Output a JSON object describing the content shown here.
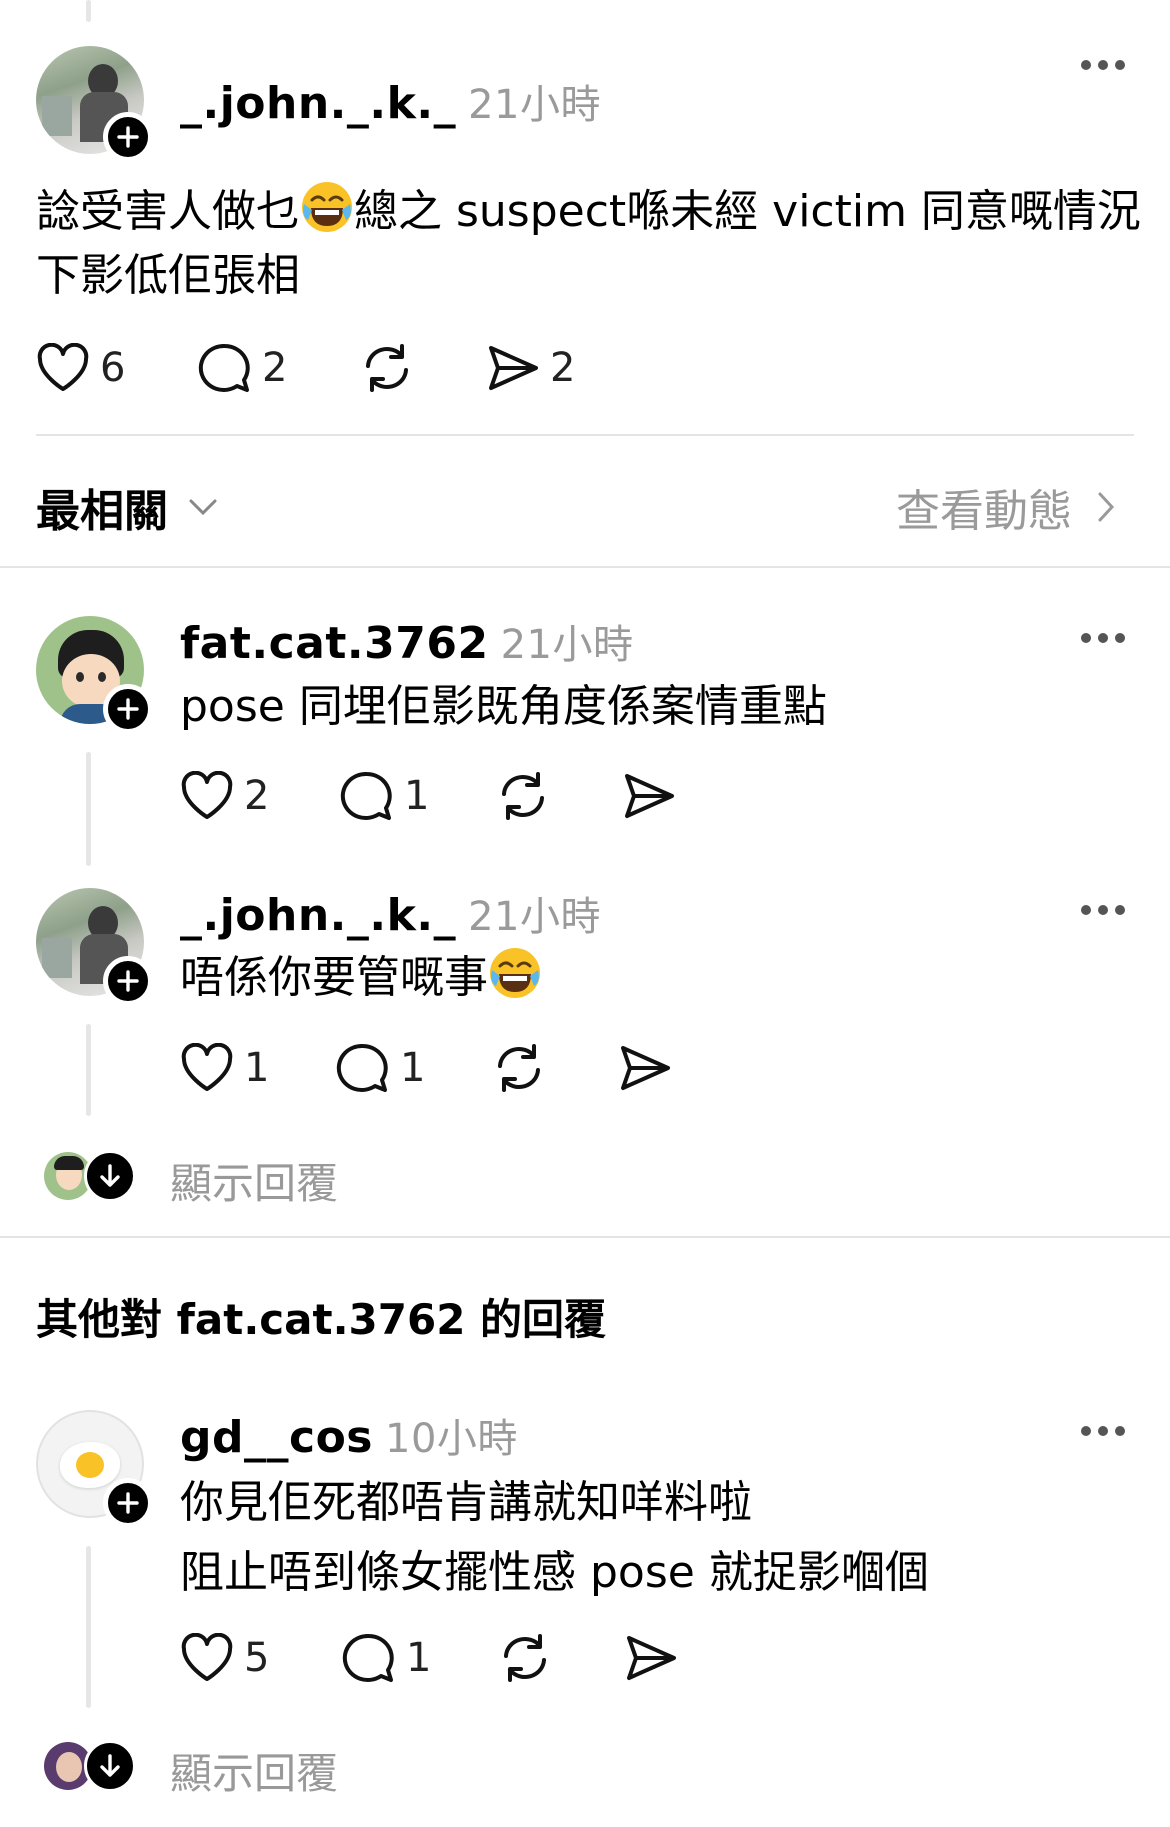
{
  "post": {
    "username": "_.john._.k._",
    "time": "21小時",
    "text_line1": "諗受害人做乜",
    "text_line1b": "總之 suspect喺未經 victim 同意嘅情況",
    "text_line2": "下影低佢張相",
    "likes": "6",
    "comments": "2",
    "shares": "2"
  },
  "sort": {
    "label": "最相關",
    "activity_link": "查看動態"
  },
  "comments": [
    {
      "username": "fat.cat.3762",
      "time": "21小時",
      "text": "pose 同埋佢影既角度係案情重點",
      "likes": "2",
      "replies": "1"
    },
    {
      "username": "_.john._.k._",
      "time": "21小時",
      "text": "唔係你要管嘅事",
      "likes": "1",
      "replies": "1"
    }
  ],
  "show_replies_1": "顯示回覆",
  "other_replies_heading": "其他對 fat.cat.3762 的回覆",
  "reply": {
    "username": "gd__cos",
    "time": "10小時",
    "text_line1": "你見佢死都唔肯講就知咩料啦",
    "text_line2": "阻止唔到條女擺性感 pose 就捉影嗰個",
    "likes": "5",
    "replies": "1"
  },
  "show_replies_2": "顯示回覆",
  "icons": {
    "like": "heart-icon",
    "comment": "speech-bubble-icon",
    "repost": "repost-icon",
    "share": "send-icon",
    "more": "more-dots-icon"
  }
}
